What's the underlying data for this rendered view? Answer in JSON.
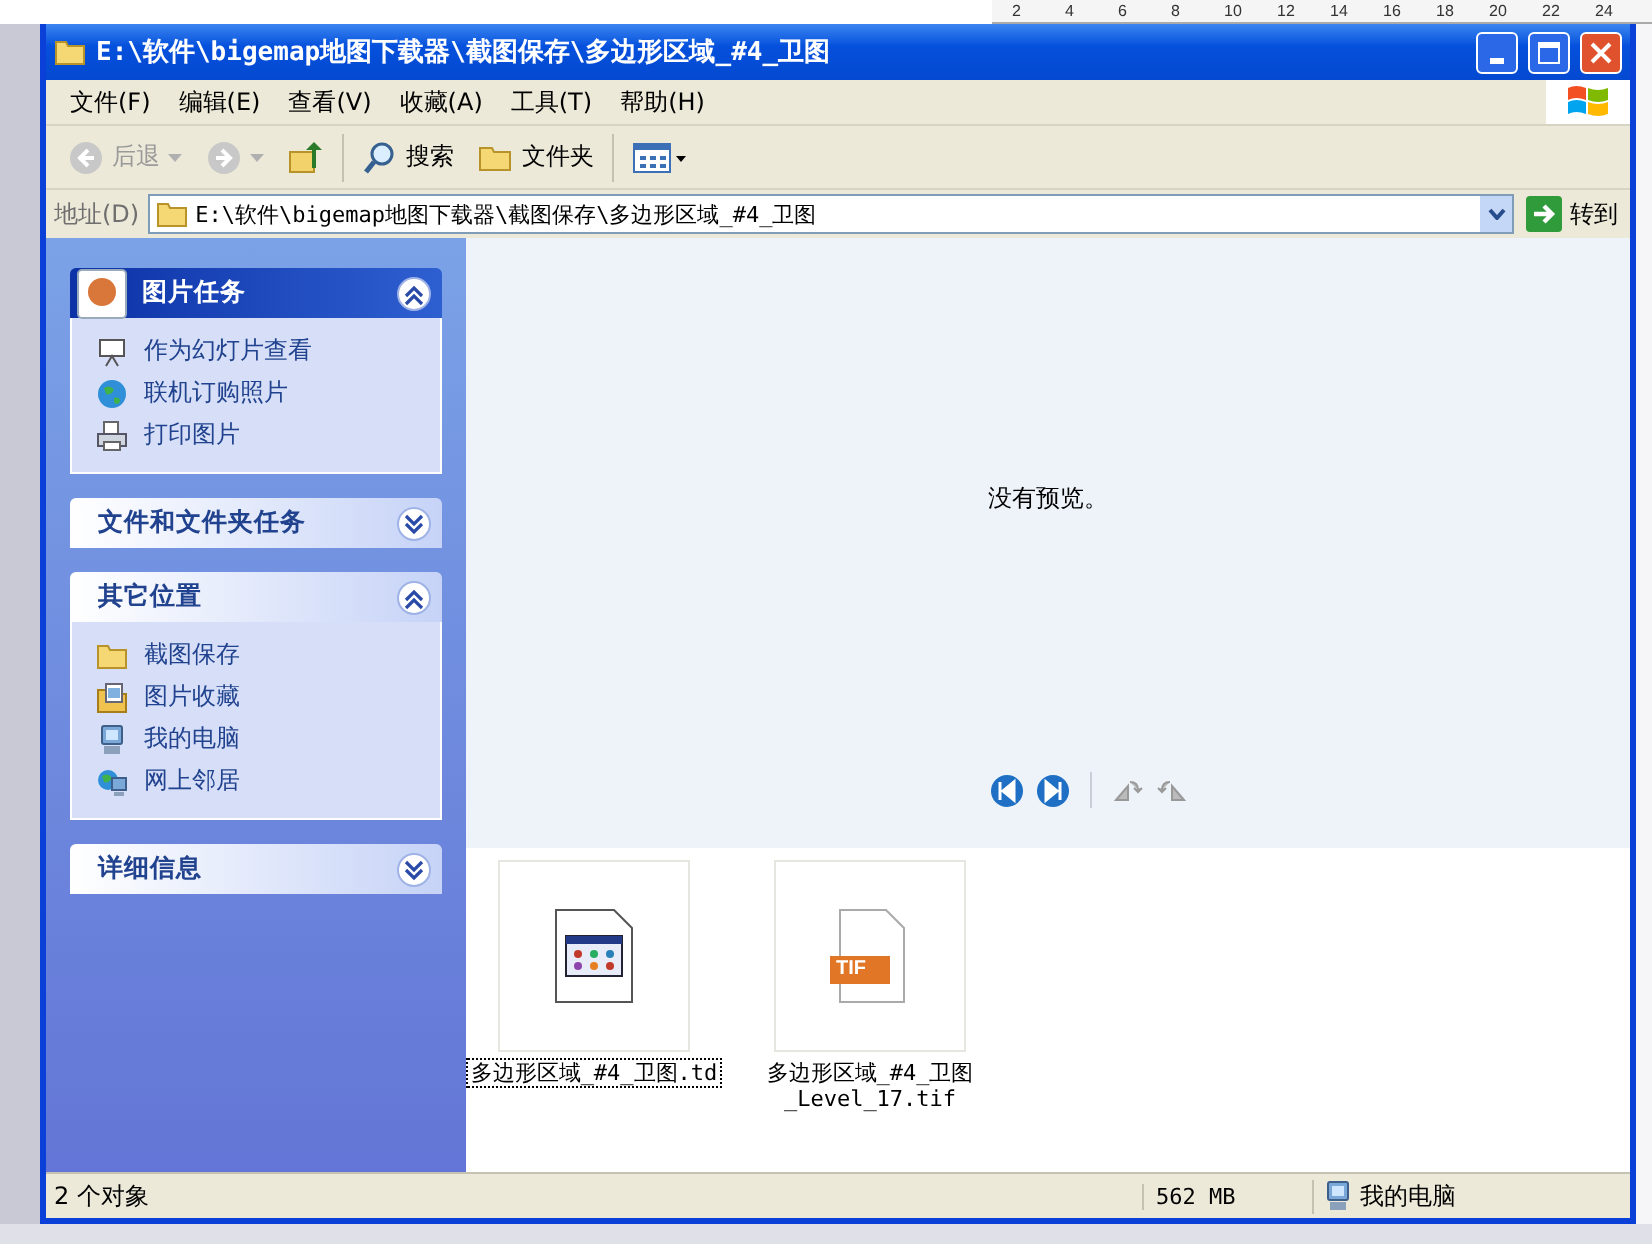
{
  "ruler": {
    "numbers": [
      "2",
      "4",
      "6",
      "8",
      "10",
      "12",
      "14",
      "16",
      "18",
      "20",
      "22",
      "24"
    ]
  },
  "window": {
    "title": "E:\\软件\\bigemap地图下载器\\截图保存\\多边形区域_#4_卫图"
  },
  "menu": [
    "文件(F)",
    "编辑(E)",
    "查看(V)",
    "收藏(A)",
    "工具(T)",
    "帮助(H)"
  ],
  "toolbar": [
    {
      "kind": "back",
      "label": "后退",
      "disabled": true
    },
    {
      "kind": "forward",
      "disabled": true
    },
    {
      "kind": "up",
      "disabled": false
    },
    {
      "kind": "search",
      "label": "搜索",
      "disabled": false
    },
    {
      "kind": "folders",
      "label": "文件夹",
      "disabled": false
    },
    {
      "kind": "views",
      "disabled": false
    }
  ],
  "address": {
    "label": "地址(D)",
    "value": "E:\\软件\\bigemap地图下载器\\截图保存\\多边形区域_#4_卫图",
    "go": "转到"
  },
  "sidebar": {
    "panels": [
      {
        "title": "图片任务",
        "kind": "special",
        "expanded": true,
        "items": [
          {
            "label": "作为幻灯片查看",
            "kind": "slideshow"
          },
          {
            "label": "联机订购照片",
            "kind": "globe"
          },
          {
            "label": "打印图片",
            "kind": "printer"
          }
        ]
      },
      {
        "title": "文件和文件夹任务",
        "kind": "normal",
        "expanded": false
      },
      {
        "title": "其它位置",
        "kind": "normal",
        "expanded": true,
        "items": [
          {
            "label": "截图保存",
            "kind": "folder"
          },
          {
            "label": "图片收藏",
            "kind": "pictures"
          },
          {
            "label": "我的电脑",
            "kind": "computer"
          },
          {
            "label": "网上邻居",
            "kind": "network"
          }
        ]
      },
      {
        "title": "详细信息",
        "kind": "normal",
        "expanded": false
      }
    ]
  },
  "preview": {
    "message": "没有预览。"
  },
  "files": [
    {
      "name": "多边形区域_#4_卫图.td",
      "kind": "td",
      "selected": true
    },
    {
      "name": "多边形区域_#4_卫图_Level_17.tif",
      "kind": "tif",
      "badge": "TIF",
      "selected": false
    }
  ],
  "status_bar": {
    "objects": "2 个对象",
    "size": "562 MB",
    "zone": "我的电脑"
  }
}
